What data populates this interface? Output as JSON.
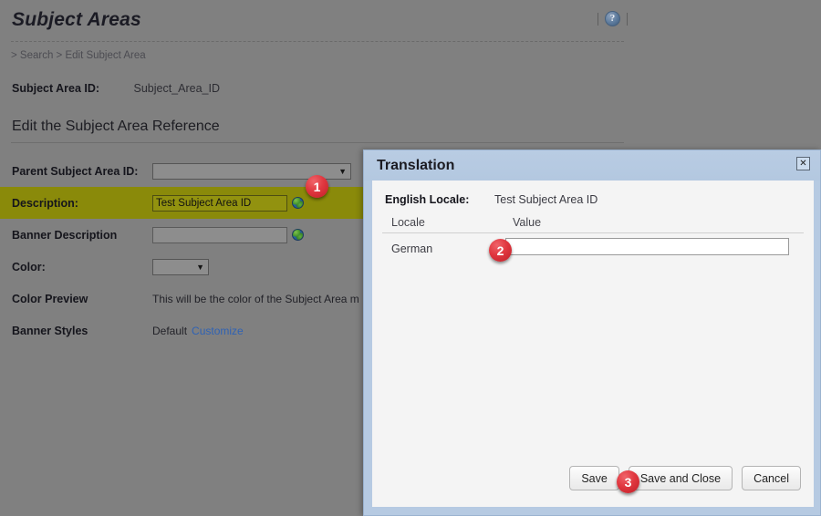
{
  "page": {
    "title": "Subject Areas",
    "help_icon": "help-circle-icon",
    "breadcrumb": "> Search > Edit Subject Area",
    "subject_area_id_label": "Subject Area ID:",
    "subject_area_id_value": "Subject_Area_ID",
    "section_title": "Edit the Subject Area Reference"
  },
  "form": {
    "parent_label": "Parent Subject Area ID:",
    "parent_value": "",
    "description_label": "Description:",
    "description_value": "Test Subject Area ID",
    "banner_description_label": "Banner Description",
    "banner_description_value": "",
    "color_label": "Color:",
    "color_value": "",
    "color_preview_label": "Color Preview",
    "color_preview_text": "This will be the color of the Subject Area m",
    "banner_styles_label": "Banner Styles",
    "banner_styles_value": "Default",
    "banner_styles_link": "Customize",
    "globe_icon": "globe-translate-icon"
  },
  "dialog": {
    "title": "Translation",
    "close_label": "✕",
    "english_locale_label": "English Locale:",
    "english_locale_value": "Test Subject Area ID",
    "columns": {
      "locale": "Locale",
      "value": "Value"
    },
    "rows": [
      {
        "locale": "German",
        "value": ""
      }
    ],
    "buttons": {
      "save": "Save",
      "save_and_close": "Save and Close",
      "cancel": "Cancel"
    }
  },
  "callouts": {
    "one": "1",
    "two": "2",
    "three": "3"
  },
  "colors": {
    "page_bg": "#808080",
    "highlight_row": "#8a8a0a",
    "dialog_frame": "#b6cae2",
    "dialog_body": "#f4f4f4",
    "badge_red": "#e0373f",
    "link_blue": "#2f62b4"
  }
}
